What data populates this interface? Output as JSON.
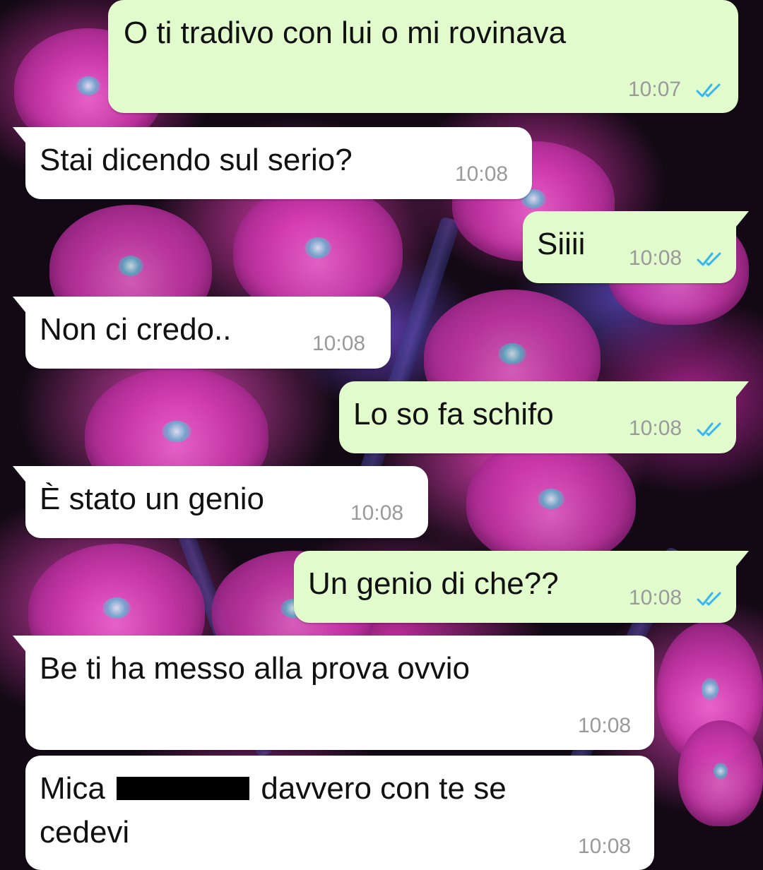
{
  "conversation": {
    "messages": [
      {
        "direction": "out",
        "text": "O ti tradivo con lui o mi rovinava",
        "time": "10:07",
        "status": "read"
      },
      {
        "direction": "in",
        "text": "Stai dicendo sul serio?",
        "time": "10:08"
      },
      {
        "direction": "out",
        "text": "Siiii",
        "time": "10:08",
        "status": "read"
      },
      {
        "direction": "in",
        "text": "Non ci credo..",
        "time": "10:08"
      },
      {
        "direction": "out",
        "text": "Lo so fa schifo",
        "time": "10:08",
        "status": "read"
      },
      {
        "direction": "in",
        "text": "È stato un genio",
        "time": "10:08"
      },
      {
        "direction": "out",
        "text": "Un genio di che??",
        "time": "10:08",
        "status": "read"
      },
      {
        "direction": "in",
        "text": "Be ti ha messo alla prova ovvio",
        "time": "10:08"
      },
      {
        "direction": "in",
        "text_before_redaction": "Mica",
        "text_after_redaction": "davvero con te se",
        "text_line2": "cedevi",
        "redacted": true,
        "time": "10:08"
      }
    ]
  },
  "colors": {
    "incoming_bubble": "#ffffff",
    "outgoing_bubble": "#e1fbcd",
    "timestamp": "#9a9a9a",
    "read_ticks": "#34b7f1",
    "message_text": "#111111",
    "wallpaper_flowers": "#d23ab0"
  },
  "icons": {
    "read_status": "double-check-icon"
  }
}
